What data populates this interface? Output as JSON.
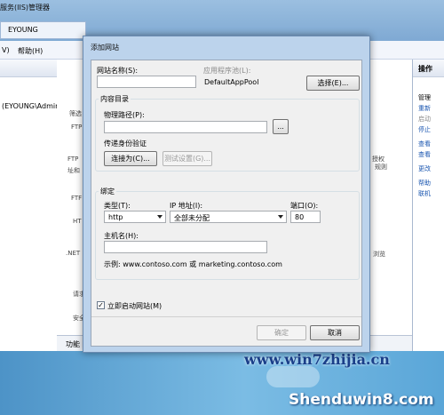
{
  "background": {
    "window_title": "服务(IIS)管理器",
    "address": "EYOUNG",
    "menu": [
      "V)",
      "帮助(H)"
    ],
    "tree_item": "(EYOUNG\\Admin",
    "center_labels": [
      "筛选",
      "FTP",
      "FTP",
      "址和",
      "FTF",
      "HT",
      ".NET",
      "请求",
      "安全"
    ],
    "feature_right": [
      "授权",
      "规则",
      "浏览"
    ],
    "bottom_tab": "功能",
    "actions_header": "操作",
    "actions": [
      "管理",
      "重新",
      "启动",
      "停止",
      "查看",
      "查看",
      "更改",
      "帮助",
      "联机"
    ]
  },
  "watermark": {
    "line1": "www.win7zhijia.cn",
    "line2": "Shenduwin8.com"
  },
  "dialog": {
    "title": "添加网站",
    "site_name_label": "网站名称(S):",
    "site_name_value": "",
    "app_pool_label": "应用程序池(L):",
    "app_pool_value": "DefaultAppPool",
    "select_button": "选择(E)...",
    "content_dir_title": "内容目录",
    "physical_path_label": "物理路径(P):",
    "physical_path_value": "",
    "browse_button": "...",
    "passthrough_label": "传递身份验证",
    "connect_as_button": "连接为(C)...",
    "test_settings_button": "测试设置(G)...",
    "binding_title": "绑定",
    "type_label": "类型(T):",
    "type_value": "http",
    "ip_label": "IP 地址(I):",
    "ip_value": "全部未分配",
    "port_label": "端口(O):",
    "port_value": "80",
    "hostname_label": "主机名(H):",
    "hostname_value": "",
    "example_text": "示例: www.contoso.com 或 marketing.contoso.com",
    "start_now_label": "立即启动网站(M)",
    "start_now_checked": true,
    "ok_button": "确定",
    "cancel_button": "取消"
  }
}
